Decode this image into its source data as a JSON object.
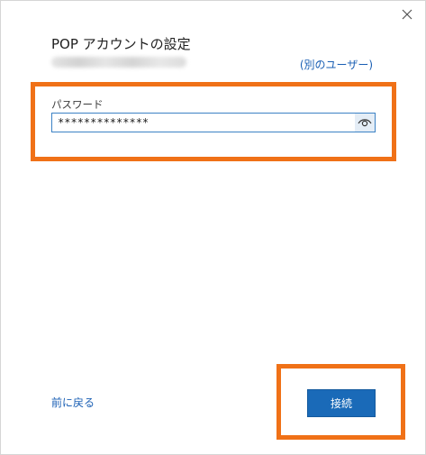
{
  "dialog": {
    "title": "POP アカウントの設定",
    "other_user_link": "(別のユーザー)",
    "close_icon": "close-icon"
  },
  "password": {
    "label": "パスワード",
    "value": "**************",
    "reveal_icon": "eye-icon"
  },
  "footer": {
    "back_label": "前に戻る",
    "connect_label": "接続"
  },
  "colors": {
    "accent": "#1a6ab8",
    "link": "#1a5fb4",
    "highlight": "#f07117"
  }
}
